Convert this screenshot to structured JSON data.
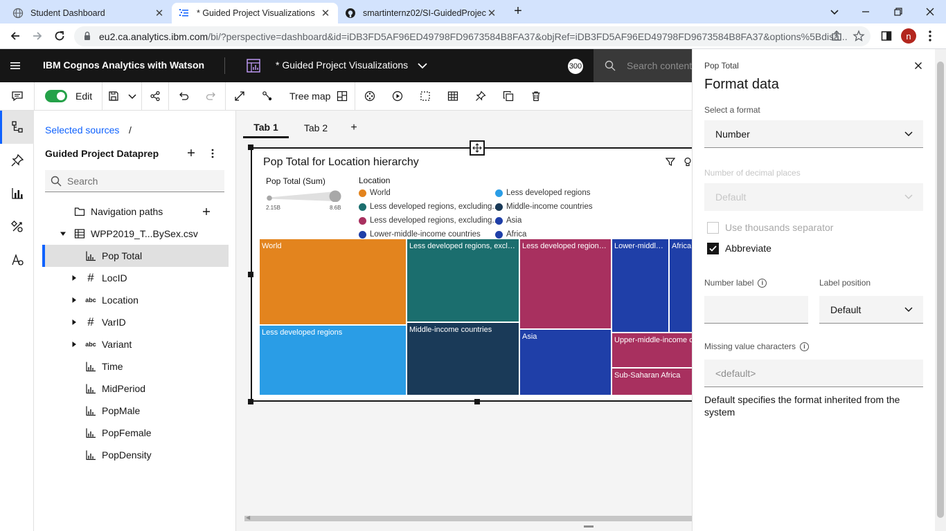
{
  "browser": {
    "tabs": [
      {
        "title": "Student Dashboard"
      },
      {
        "title": "* Guided Project Visualizations"
      },
      {
        "title": "smartinternz02/SI-GuidedProject"
      }
    ],
    "url_host": "eu2.ca.analytics.ibm.com",
    "url_path": "/bi/?perspective=dashboard&id=iDB3FD5AF96ED49798FD9673584B8FA37&objRef=iDB3FD5AF96ED49798FD9673584B8FA37&options%5Bdisa...",
    "profile_initial": "n"
  },
  "app": {
    "brand": "IBM Cognos Analytics with Watson",
    "dashboard_title": "* Guided Project Visualizations",
    "notification_count": "300",
    "search_placeholder": "Search content"
  },
  "toolbar": {
    "edit_label": "Edit",
    "viz_type": "Tree map"
  },
  "data_panel": {
    "breadcrumb": "Selected sources",
    "breadcrumb_sep": "/",
    "source_title": "Guided Project Dataprep",
    "search_placeholder": "Search",
    "tree": {
      "nav_paths": "Navigation paths",
      "file": "WPP2019_T...BySex.csv",
      "items": [
        {
          "label": "Pop Total",
          "kind": "measure"
        },
        {
          "label": "LocID",
          "kind": "number"
        },
        {
          "label": "Location",
          "kind": "text"
        },
        {
          "label": "VarID",
          "kind": "number"
        },
        {
          "label": "Variant",
          "kind": "text"
        },
        {
          "label": "Time",
          "kind": "measure"
        },
        {
          "label": "MidPeriod",
          "kind": "measure"
        },
        {
          "label": "PopMale",
          "kind": "measure"
        },
        {
          "label": "PopFemale",
          "kind": "measure"
        },
        {
          "label": "PopDensity",
          "kind": "measure"
        }
      ],
      "text_type_abbr": "abc"
    }
  },
  "canvas": {
    "tabs": [
      "Tab 1",
      "Tab 2"
    ],
    "add_tab": "+"
  },
  "chart_data": {
    "type": "treemap",
    "title": "Pop Total for Location hierarchy",
    "size_legend": {
      "title": "Pop Total (Sum)",
      "min_label": "2.15B",
      "max_label": "8.6B"
    },
    "color_legend_title": "Location",
    "legend": [
      {
        "name": "World",
        "color": "#e3841e"
      },
      {
        "name": "Less developed regions",
        "color": "#2a9de6"
      },
      {
        "name": "Less developed regions, excluding...",
        "color": "#1b6e6e"
      },
      {
        "name": "Middle-income countries",
        "color": "#1a3a58"
      },
      {
        "name": "Less developed regions, excluding...",
        "color": "#a8305f"
      },
      {
        "name": "Asia",
        "color": "#1f3fa8"
      },
      {
        "name": "Lower-middle-income countries",
        "color": "#1f3fa8"
      },
      {
        "name": "Africa",
        "color": "#1f3fa8"
      }
    ],
    "tiles": [
      {
        "label": "World",
        "color": "#e3841e"
      },
      {
        "label": "Less developed regions",
        "color": "#2a9de6"
      },
      {
        "label": "Less developed regions, exclu...",
        "color": "#1b6e6e"
      },
      {
        "label": "Middle-income countries",
        "color": "#1a3a58"
      },
      {
        "label": "Less developed regions, ...",
        "color": "#a8305f"
      },
      {
        "label": "Asia",
        "color": "#1f3fa8"
      },
      {
        "label": "Lower-middle...",
        "color": "#1f3fa8"
      },
      {
        "label": "Africa",
        "color": "#1f3fa8"
      },
      {
        "label": "Upper-middle-income c",
        "color": "#a8305f"
      },
      {
        "label": "Sub-Saharan Africa",
        "color": "#a8305f"
      }
    ]
  },
  "format_panel": {
    "subtitle": "Pop Total",
    "title": "Format data",
    "select_format_label": "Select a format",
    "select_format_value": "Number",
    "decimals_label": "Number of decimal places",
    "decimals_value": "Default",
    "thousands_label": "Use thousands separator",
    "thousands_checked": false,
    "abbreviate_label": "Abbreviate",
    "abbreviate_checked": true,
    "number_label_label": "Number label",
    "number_label_value": "",
    "label_position_label": "Label position",
    "label_position_value": "Default",
    "missing_label": "Missing value characters",
    "missing_placeholder": "<default>",
    "help_text": "Default specifies the format inherited from the system"
  }
}
